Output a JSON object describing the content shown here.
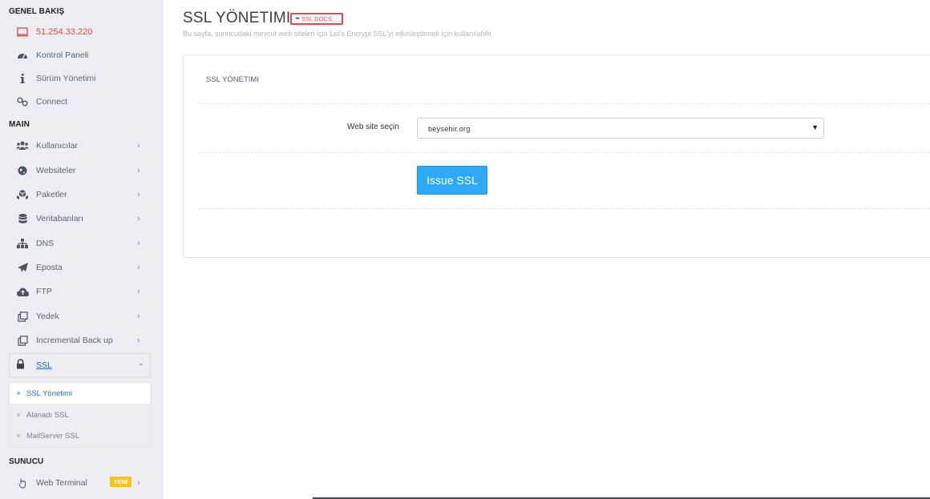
{
  "sidebar": {
    "sections": {
      "overview": "GENEL BAKIŞ",
      "main": "MAIN",
      "server": "SUNUCU"
    },
    "overview_items": [
      {
        "label": "51.254.33.220",
        "icon": "monitor-icon"
      },
      {
        "label": "Kontrol Paneli",
        "icon": "dashboard-icon"
      },
      {
        "label": "Sürüm Yönetimi",
        "icon": "info-icon"
      },
      {
        "label": "Connect",
        "icon": "link-icon"
      }
    ],
    "main_items": [
      {
        "label": "Kullanıcılar",
        "icon": "users-icon"
      },
      {
        "label": "Websiteler",
        "icon": "globe-icon"
      },
      {
        "label": "Paketler",
        "icon": "cubes-icon"
      },
      {
        "label": "Veritabanları",
        "icon": "database-icon"
      },
      {
        "label": "DNS",
        "icon": "sitemap-icon"
      },
      {
        "label": "Eposta",
        "icon": "paper-plane-icon"
      },
      {
        "label": "FTP",
        "icon": "cloud-upload-icon"
      },
      {
        "label": "Yedek",
        "icon": "copy-icon"
      },
      {
        "label": "Incremental Back up",
        "icon": "copy-icon"
      }
    ],
    "ssl": {
      "label": "SSL",
      "icon": "lock-icon",
      "submenu": [
        "SSL Yönetimi",
        "Alanadı SSL",
        "MailServer SSL"
      ]
    },
    "server_items": [
      {
        "label": "Web Terminal",
        "icon": "terminal-icon",
        "badge": "YENİ"
      }
    ]
  },
  "header": {
    "title": "SSL YÖNETIMI -",
    "docs_label": "SSL DOCS",
    "subtitle": "Bu sayfa, sunucudaki mevcut web siteleri için Let's Encrypt SSL'yi etkinleştirmek için kullanılabilir."
  },
  "card": {
    "title": "SSL YÖNETIMI",
    "website_label": "Web site seçin",
    "website_value": "beysehir.org",
    "button_label": "Issue SSL"
  },
  "colors": {
    "accent": "#2ea9f7",
    "ip": "#e8454a",
    "badge": "#f7c21a",
    "sidebar_bg": "#eceef3"
  }
}
